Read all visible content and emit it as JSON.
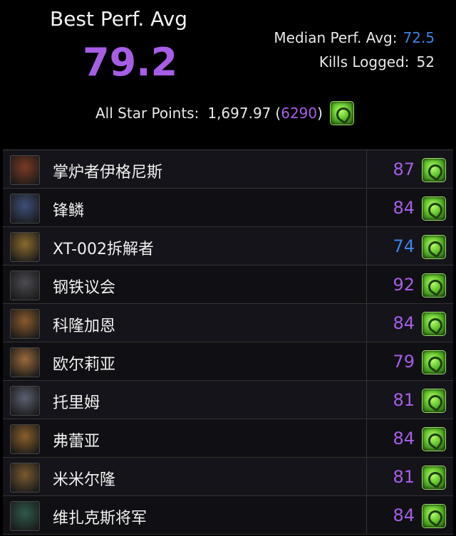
{
  "header": {
    "best_title": "Best Perf. Avg",
    "best_value": "79.2",
    "median_label": "Median Perf. Avg:",
    "median_value": "72.5",
    "kills_label": "Kills Logged:",
    "kills_value": "52",
    "all_star_label": "All Star Points:",
    "all_star_value": "1,697.97",
    "all_star_open": "(",
    "all_star_rank": "6290",
    "all_star_close": ")",
    "icon": "gem-icon"
  },
  "colors": {
    "purple": "#a65ee6",
    "blue": "#3f82e6",
    "background": "#000000"
  },
  "bosses": [
    {
      "name": "掌炉者伊格尼斯",
      "score": "87",
      "score_color": "purple",
      "avatar_color": "#7a3a22"
    },
    {
      "name": "锋鳞",
      "score": "84",
      "score_color": "purple",
      "avatar_color": "#3d4f7a"
    },
    {
      "name": "XT-002拆解者",
      "score": "74",
      "score_color": "blue",
      "avatar_color": "#8a6a2e"
    },
    {
      "name": "钢铁议会",
      "score": "92",
      "score_color": "purple",
      "avatar_color": "#4b4b52"
    },
    {
      "name": "科隆加恩",
      "score": "84",
      "score_color": "purple",
      "avatar_color": "#8a5a2c"
    },
    {
      "name": "欧尔莉亚",
      "score": "79",
      "score_color": "purple",
      "avatar_color": "#9a6a3a"
    },
    {
      "name": "托里姆",
      "score": "81",
      "score_color": "purple",
      "avatar_color": "#5a6070"
    },
    {
      "name": "弗蕾亚",
      "score": "84",
      "score_color": "purple",
      "avatar_color": "#8a5f2a"
    },
    {
      "name": "米米尔隆",
      "score": "81",
      "score_color": "purple",
      "avatar_color": "#7a5a30"
    },
    {
      "name": "维扎克斯将军",
      "score": "84",
      "score_color": "purple",
      "avatar_color": "#2e5a4a"
    }
  ]
}
